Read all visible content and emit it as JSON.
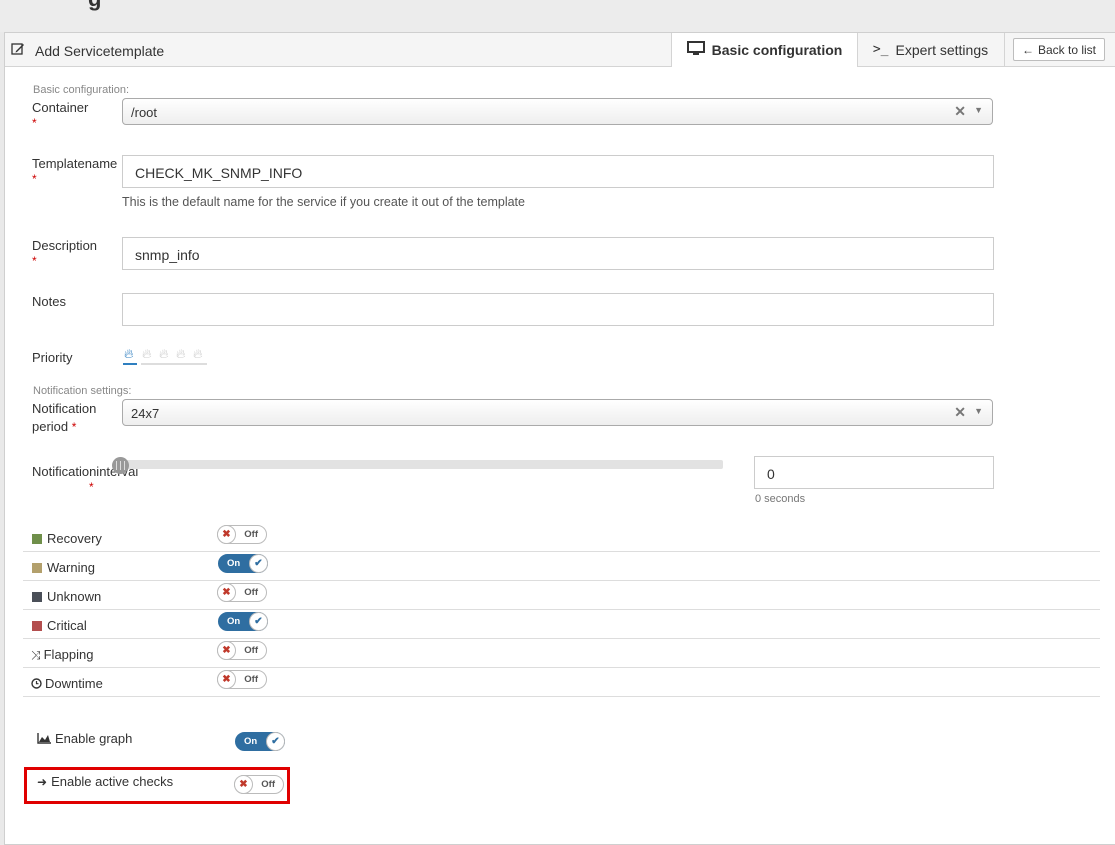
{
  "page": {
    "top_title": "g"
  },
  "header": {
    "title": "Add Servicetemplate",
    "tabs": {
      "basic": "Basic configuration",
      "expert": "Expert settings"
    },
    "back_button": "Back to list"
  },
  "basic_section": {
    "legend": "Basic configuration:",
    "container": {
      "label": "Container",
      "value": "/root"
    },
    "templatename": {
      "label": "Templatename",
      "value": "CHECK_MK_SNMP_INFO",
      "help": "This is the default name for the service if you create it out of the template"
    },
    "description": {
      "label": "Description",
      "value": "snmp_info"
    },
    "notes": {
      "label": "Notes",
      "value": ""
    },
    "priority": {
      "label": "Priority",
      "selected": 1,
      "max": 5
    }
  },
  "notification_section": {
    "legend": "Notification settings:",
    "period": {
      "label_line1": "Notification",
      "label_line2": "period",
      "value": "24x7"
    },
    "interval": {
      "label": "Notificationinterval",
      "value": "0",
      "unit_text": "0 seconds"
    },
    "options": [
      {
        "label": "Recovery",
        "state": "Off",
        "color": "#6f8f4a",
        "icon": "square"
      },
      {
        "label": "Warning",
        "state": "On",
        "color": "#b3a06c",
        "icon": "square"
      },
      {
        "label": "Unknown",
        "state": "Off",
        "color": "#4a4f58",
        "icon": "square"
      },
      {
        "label": "Critical",
        "state": "On",
        "color": "#b34e4e",
        "icon": "square"
      },
      {
        "label": "Flapping",
        "state": "Off",
        "color": "#333333",
        "icon": "random-icon"
      },
      {
        "label": "Downtime",
        "state": "Off",
        "color": "#333333",
        "icon": "clock-icon"
      }
    ]
  },
  "extra": {
    "enable_graph": {
      "label": "Enable graph",
      "state": "On"
    },
    "enable_active_checks": {
      "label": "Enable active checks",
      "state": "Off"
    }
  },
  "colors": {
    "accent": "#2f6ea1",
    "required": "#cc0000",
    "highlight": "#e00000"
  }
}
